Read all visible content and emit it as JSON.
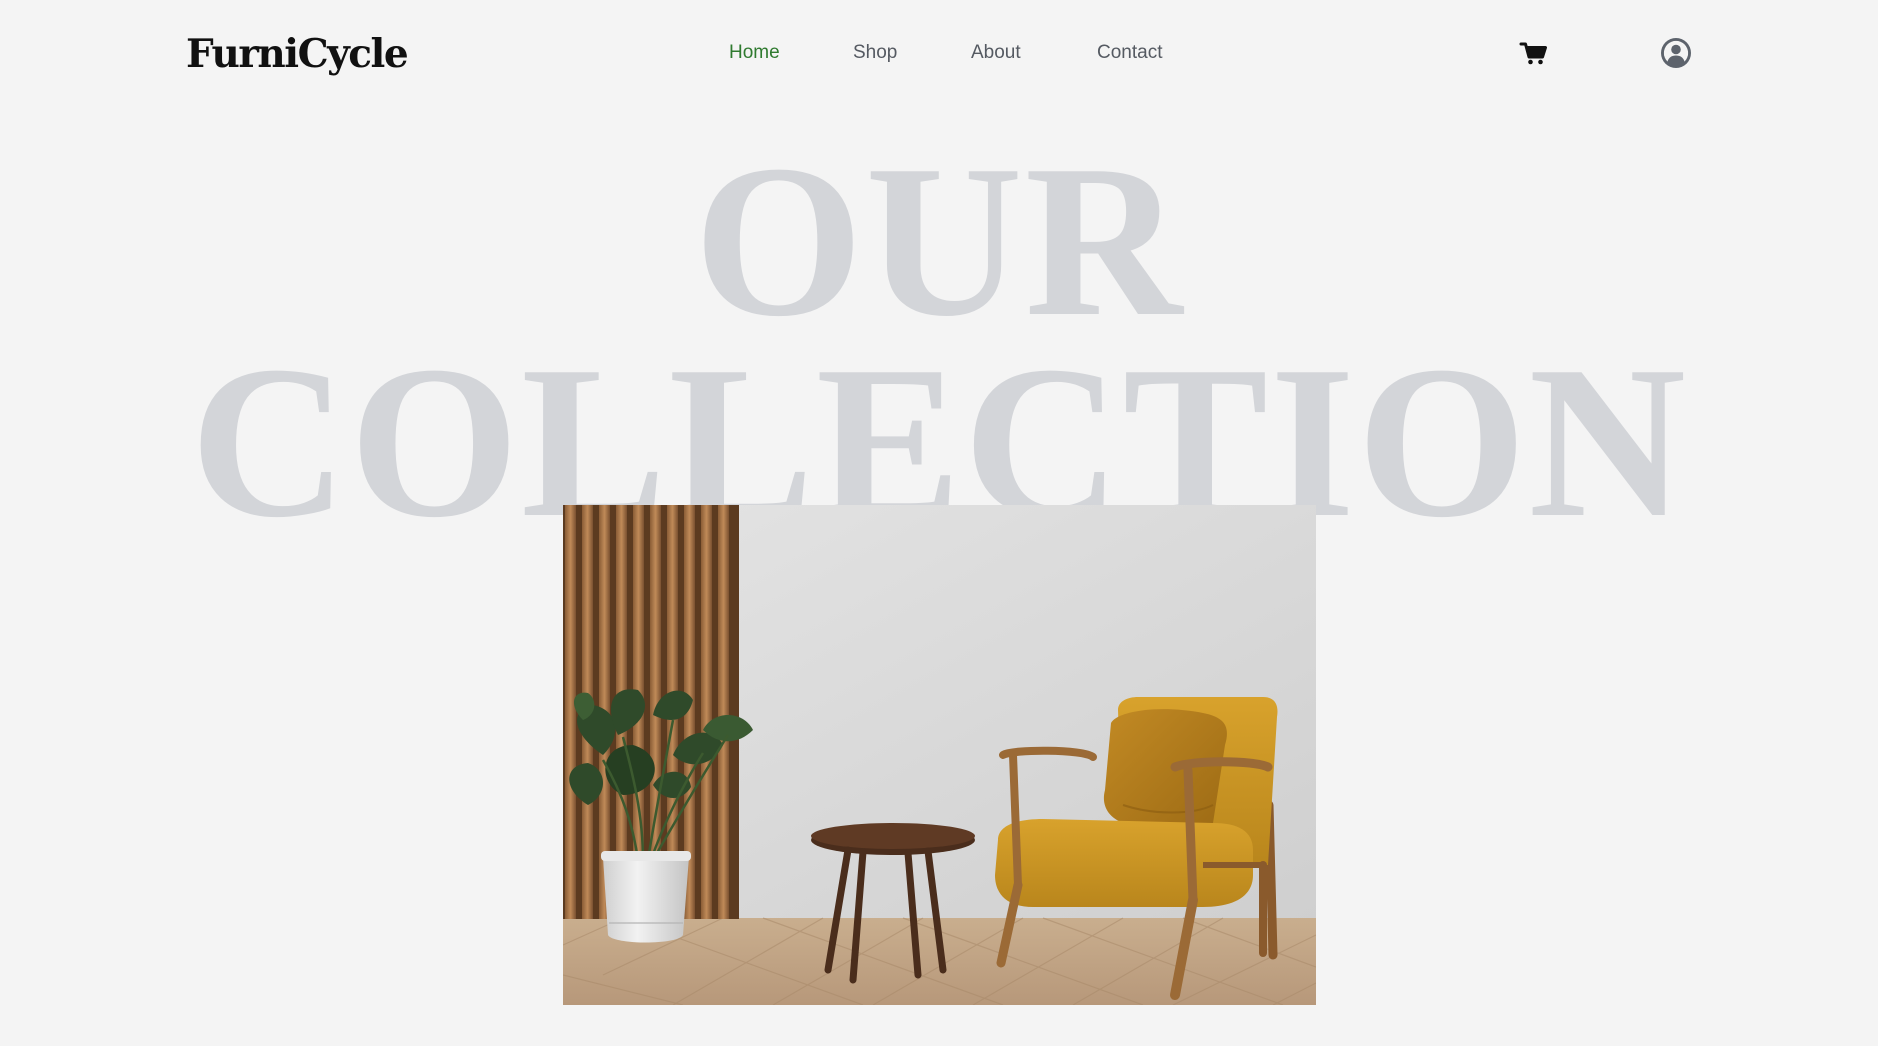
{
  "brand": {
    "name": "FurniCycle"
  },
  "nav": {
    "items": [
      {
        "label": "Home",
        "active": true
      },
      {
        "label": "Shop",
        "active": false
      },
      {
        "label": "About",
        "active": false
      },
      {
        "label": "Contact",
        "active": false
      }
    ]
  },
  "header_icons": {
    "cart": "cart-icon",
    "account": "user-circle-icon"
  },
  "hero": {
    "title_line1": "OUR",
    "title_line2": "COLLECTION",
    "image": "living-room-armchair-photo"
  },
  "colors": {
    "background": "#f4f4f4",
    "nav_active": "#2f7a2f",
    "nav_default": "#555a62",
    "hero_text": "#d3d5d9",
    "logo": "#111111"
  }
}
